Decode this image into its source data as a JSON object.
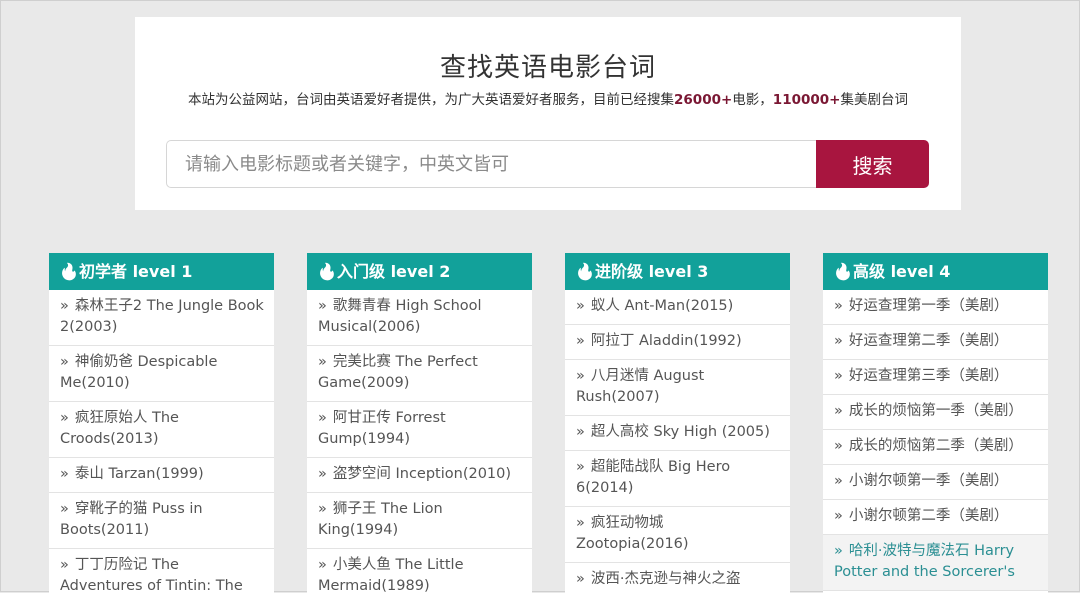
{
  "hero": {
    "title": "查找英语电影台词",
    "desc_pre": "本站为公益网站，台词由英语爱好者提供，为广大英语爱好者服务，目前已经搜集",
    "movie_count": "26000+",
    "desc_mid": "电影，",
    "episode_count": "110000+",
    "desc_post": "集美剧台词"
  },
  "search": {
    "placeholder": "请输入电影标题或者关键字，中英文皆可",
    "button_label": "搜索"
  },
  "colors": {
    "accent_teal": "#12a19a",
    "brand_red": "#a8153f"
  },
  "columns": [
    {
      "header": "初学者 level 1",
      "icon": "fire-icon",
      "items": [
        "森林王子2 The Jungle Book 2(2003)",
        "神偷奶爸 Despicable Me(2010)",
        "疯狂原始人 The Croods(2013)",
        "泰山 Tarzan(1999)",
        "穿靴子的猫 Puss in Boots(2011)",
        "丁丁历险记 The Adventures of Tintin: The"
      ]
    },
    {
      "header": "入门级 level 2",
      "icon": "fire-icon",
      "items": [
        "歌舞青春 High School Musical(2006)",
        "完美比赛 The Perfect Game(2009)",
        "阿甘正传 Forrest Gump(1994)",
        "盗梦空间 Inception(2010)",
        "狮子王 The Lion King(1994)",
        "小美人鱼 The Little Mermaid(1989)"
      ]
    },
    {
      "header": "进阶级 level 3",
      "icon": "fire-icon",
      "items": [
        "蚁人 Ant-Man(2015)",
        "阿拉丁 Aladdin(1992)",
        "八月迷情 August Rush(2007)",
        "超人高校 Sky High (2005)",
        "超能陆战队 Big Hero 6(2014)",
        "疯狂动物城 Zootopia(2016)",
        "波西·杰克逊与神火之盗 Percy Jackson & the"
      ]
    },
    {
      "header": "高级 level 4",
      "icon": "fire-icon",
      "items": [
        "好运查理第一季（美剧）",
        "好运查理第二季（美剧）",
        "好运查理第三季（美剧）",
        "成长的烦恼第一季（美剧）",
        "成长的烦恼第二季（美剧）",
        "小谢尔顿第一季（美剧）",
        "小谢尔顿第二季（美剧）",
        "哈利·波特与魔法石 Harry Potter and the Sorcerer's"
      ]
    }
  ]
}
